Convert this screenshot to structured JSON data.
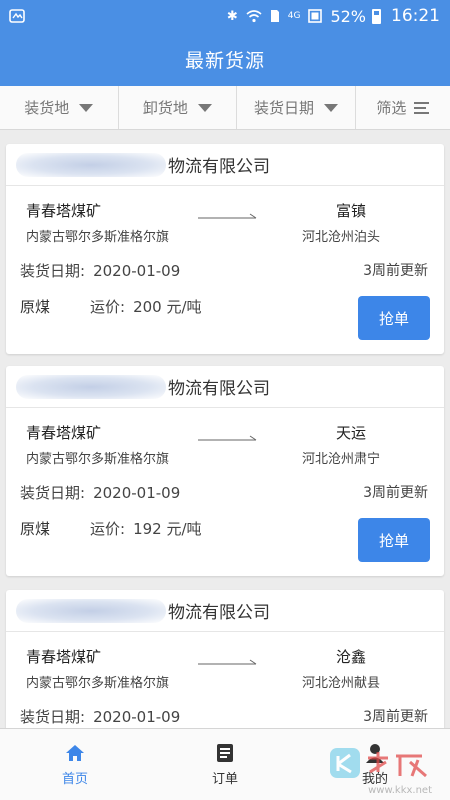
{
  "status_bar": {
    "battery": "52%",
    "time": "16:21",
    "network": "4G"
  },
  "title": "最新货源",
  "filters": [
    {
      "label": "装货地"
    },
    {
      "label": "卸货地"
    },
    {
      "label": "装货日期"
    },
    {
      "label": "筛选"
    }
  ],
  "cards": [
    {
      "company": "物流有限公司",
      "from_name": "青春塔煤矿",
      "from_place": "内蒙古鄂尔多斯准格尔旗",
      "to_name": "富镇",
      "to_place": "河北沧州泊头",
      "date_label": "装货日期:",
      "date": "2020-01-09",
      "updated": "3周前更新",
      "cargo": "原煤",
      "price_label": "运价:",
      "price": "200 元/吨",
      "button": "抢单"
    },
    {
      "company": "物流有限公司",
      "from_name": "青春塔煤矿",
      "from_place": "内蒙古鄂尔多斯准格尔旗",
      "to_name": "天运",
      "to_place": "河北沧州肃宁",
      "date_label": "装货日期:",
      "date": "2020-01-09",
      "updated": "3周前更新",
      "cargo": "原煤",
      "price_label": "运价:",
      "price": "192 元/吨",
      "button": "抢单"
    },
    {
      "company": "物流有限公司",
      "from_name": "青春塔煤矿",
      "from_place": "内蒙古鄂尔多斯准格尔旗",
      "to_name": "沧鑫",
      "to_place": "河北沧州献县",
      "date_label": "装货日期:",
      "date": "2020-01-09",
      "updated": "3周前更新"
    }
  ],
  "tabs": [
    {
      "label": "首页",
      "icon": "home-icon"
    },
    {
      "label": "订单",
      "icon": "order-icon"
    },
    {
      "label": "我的",
      "icon": "user-icon"
    }
  ],
  "watermark": "www.kkx.net",
  "colors": {
    "primary": "#4a8fe4",
    "button": "#3d86e8"
  }
}
